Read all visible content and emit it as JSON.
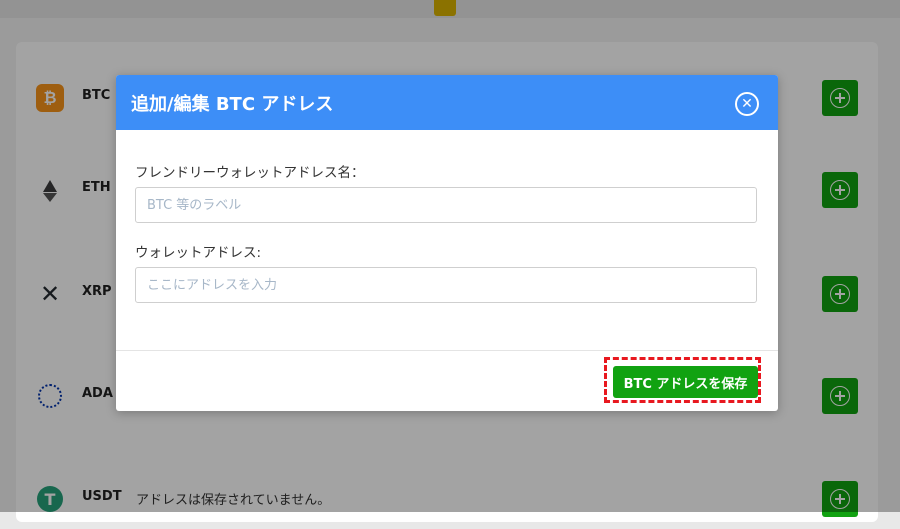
{
  "coins": [
    {
      "symbol": "BTC",
      "icon": "bitcoin-icon",
      "glyph": "₿",
      "status": ""
    },
    {
      "symbol": "ETH",
      "icon": "ethereum-icon",
      "glyph": "",
      "status": ""
    },
    {
      "symbol": "XRP",
      "icon": "xrp-icon",
      "glyph": "✕",
      "status": ""
    },
    {
      "symbol": "ADA",
      "icon": "cardano-icon",
      "glyph": "",
      "status": ""
    },
    {
      "symbol": "USDT",
      "icon": "tether-icon",
      "glyph": "T",
      "status": "アドレスは保存されていません。"
    }
  ],
  "modal": {
    "title": "追加/編集 BTC アドレス",
    "close_icon": "close-icon",
    "friendly_name_label": "フレンドリーウォレットアドレス名：",
    "friendly_name_placeholder": "BTC 等のラベル",
    "friendly_name_value": "",
    "address_label": "ウォレットアドレス:",
    "address_placeholder": "ここにアドレスを入力",
    "address_value": "",
    "save_label": "BTC アドレスを保存"
  },
  "colors": {
    "header_blue": "#3d8ef7",
    "button_green": "#11a211",
    "highlight_red": "#e8181f"
  }
}
